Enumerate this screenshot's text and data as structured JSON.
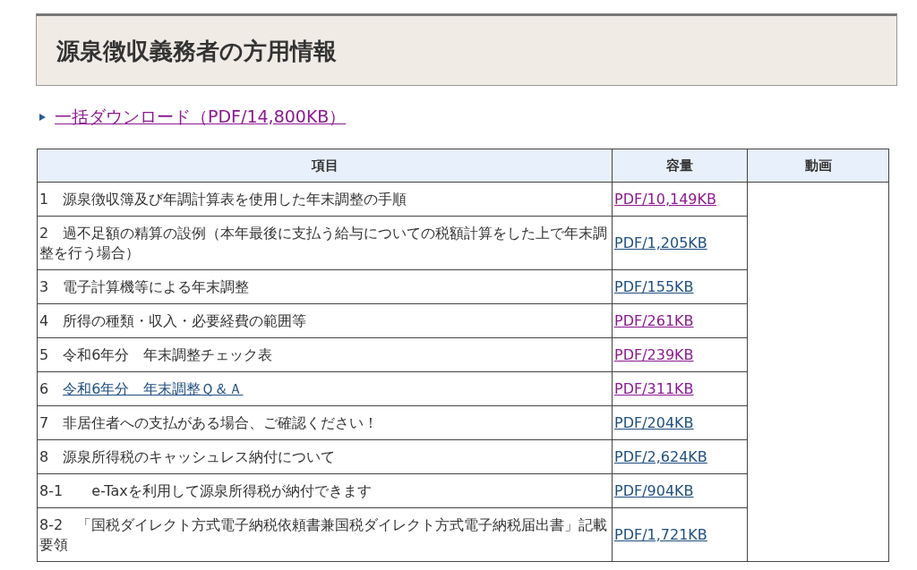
{
  "heading": "源泉徴収義務者の方用情報",
  "bulk_download": {
    "label": "一括ダウンロード（PDF/14,800KB）",
    "visited": true
  },
  "table": {
    "columns": [
      "項目",
      "容量",
      "動画"
    ],
    "rows": [
      {
        "kind": "text",
        "item": "1　源泉徴収簿及び年調計算表を使用した年末調整の手順",
        "file": "PDF/10,149KB",
        "visited": true
      },
      {
        "kind": "text",
        "item": "2　過不足額の精算の設例（本年最後に支払う給与についての税額計算をした上で年末調整を行う場合）",
        "file": "PDF/1,205KB",
        "visited": false
      },
      {
        "kind": "text",
        "item": "3　電子計算機等による年末調整",
        "file": "PDF/155KB",
        "visited": false
      },
      {
        "kind": "text",
        "item": "4　所得の種類・収入・必要経費の範囲等",
        "file": "PDF/261KB",
        "visited": true
      },
      {
        "kind": "text",
        "item": "5　令和6年分　年末調整チェック表",
        "file": "PDF/239KB",
        "visited": true
      },
      {
        "kind": "link",
        "number": "6",
        "item": "令和6年分　年末調整Ｑ＆Ａ",
        "file": "PDF/311KB",
        "visited": true
      },
      {
        "kind": "text",
        "item": "7　非居住者への支払がある場合、ご確認ください！",
        "file": "PDF/204KB",
        "visited": false
      },
      {
        "kind": "text",
        "item": "8　源泉所得税のキャッシュレス納付について",
        "file": "PDF/2,624KB",
        "visited": false
      },
      {
        "kind": "text",
        "item": "8-1　　e-Taxを利用して源泉所得税が納付できます",
        "file": "PDF/904KB",
        "visited": false
      },
      {
        "kind": "text",
        "item": "8-2　「国税ダイレクト方式電子納税依頼書兼国税ダイレクト方式電子納税届出書」記載要領",
        "file": "PDF/1,721KB",
        "visited": false
      }
    ]
  }
}
